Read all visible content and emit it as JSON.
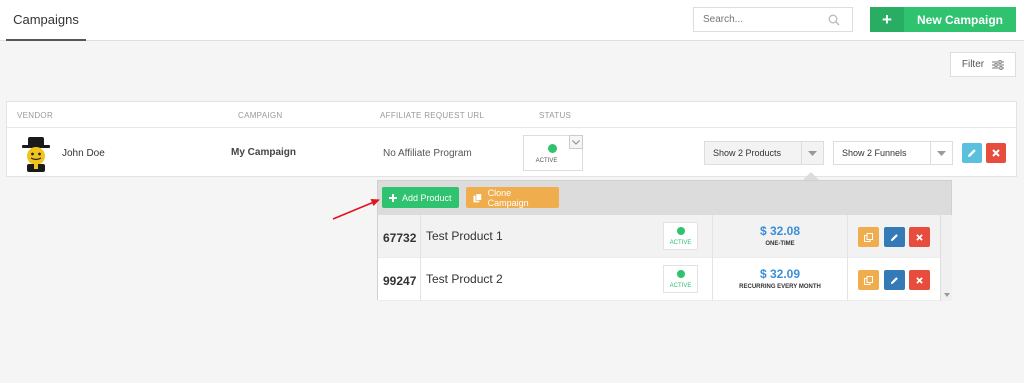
{
  "header": {
    "tab_label": "Campaigns",
    "search_placeholder": "Search...",
    "new_campaign_plus": "+",
    "new_campaign_label": "New Campaign"
  },
  "toolbar": {
    "filter_label": "Filter"
  },
  "table": {
    "columns": [
      "VENDOR",
      "CAMPAIGN",
      "AFFILIATE REQUEST URL",
      "STATUS"
    ],
    "row": {
      "vendor_name": "John Doe",
      "campaign_name": "My Campaign",
      "affiliate_url": "No Affiliate Program",
      "status": "ACTIVE",
      "products_select": "Show 2 Products",
      "funnels_select": "Show 2 Funnels"
    }
  },
  "products_panel": {
    "add_product_label": "Add Product",
    "clone_campaign_label": "Clone Campaign",
    "products": [
      {
        "id": "67732",
        "name": "Test Product 1",
        "status": "ACTIVE",
        "price": "$ 32.08",
        "price_type": "ONE-TIME"
      },
      {
        "id": "99247",
        "name": "Test Product 2",
        "status": "ACTIVE",
        "price": "$ 32.09",
        "price_type": "RECURRING EVERY MONTH"
      }
    ]
  },
  "colors": {
    "green": "#2fc26f",
    "orange": "#f0ad4e",
    "blue": "#337ab7",
    "light_blue": "#5bc0de",
    "red": "#e74c3c",
    "price_blue": "#3a8fd8",
    "annotation_arrow": "#e0141e"
  },
  "icons": [
    "search-icon",
    "plus-icon",
    "filter-sliders-icon",
    "chevron-down-icon",
    "pencil-icon",
    "close-icon",
    "copy-icon"
  ]
}
